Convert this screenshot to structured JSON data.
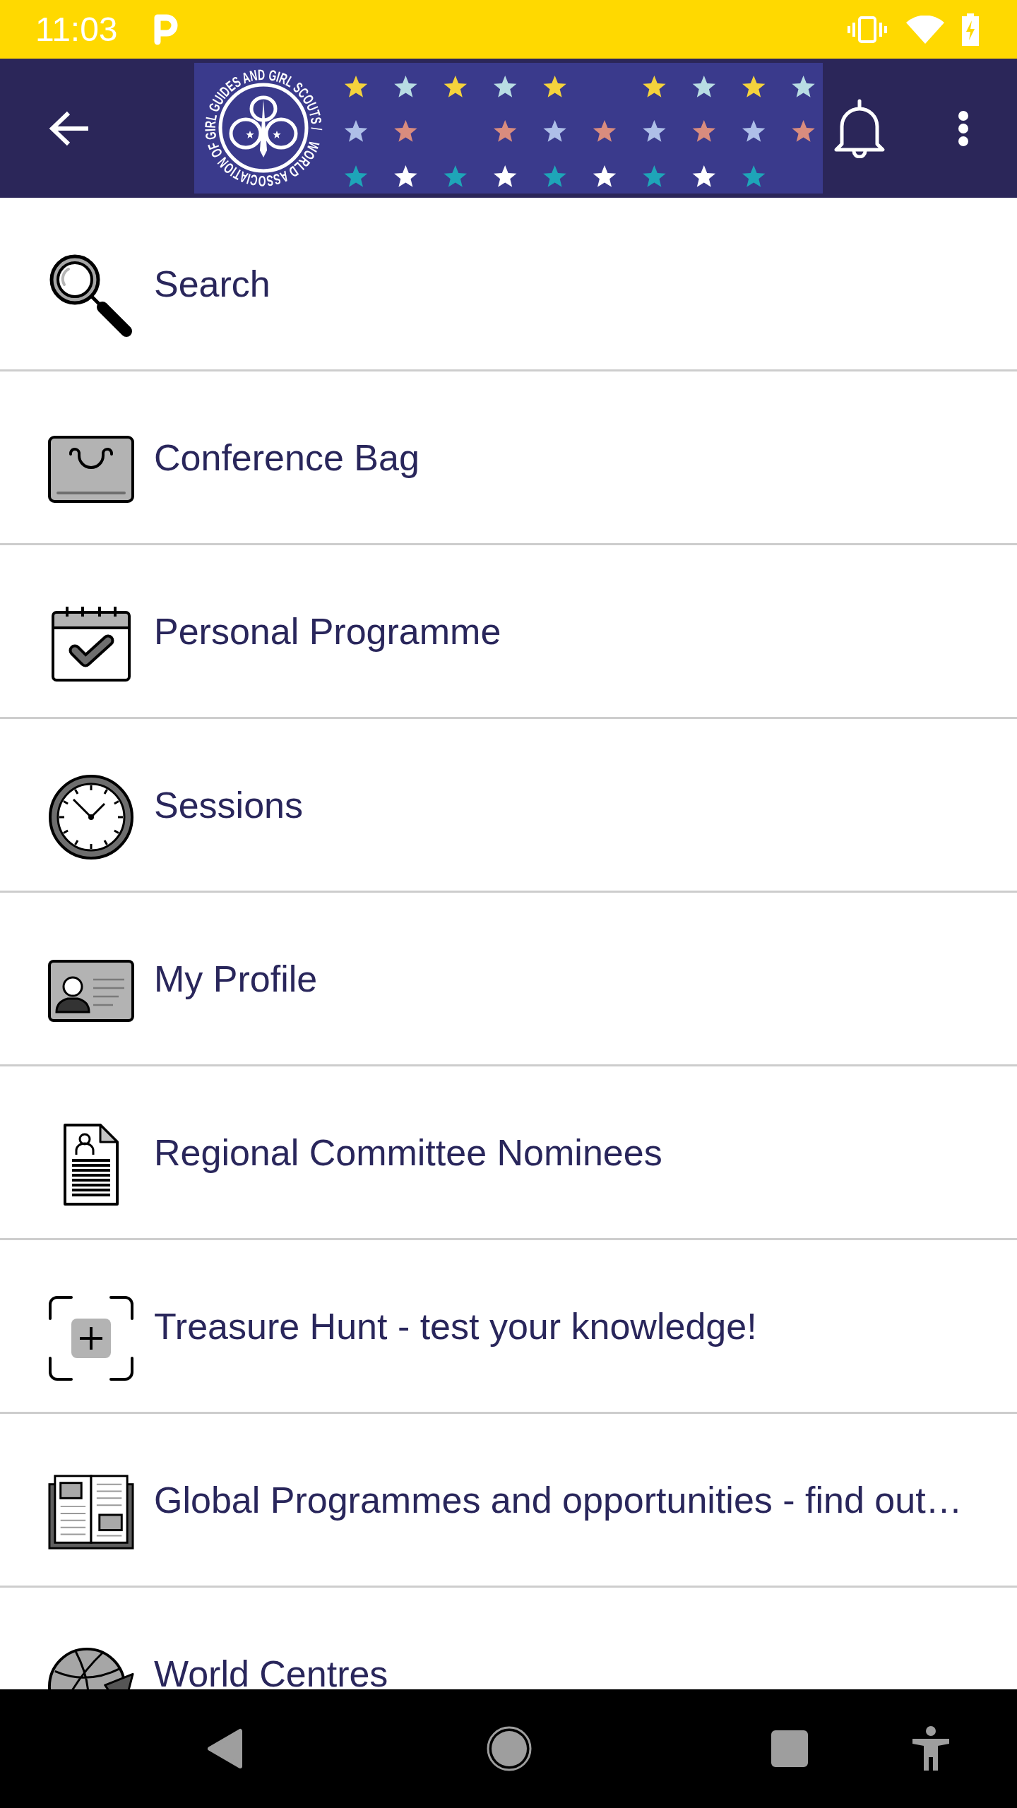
{
  "status_bar": {
    "time": "11:03"
  },
  "app_bar": {
    "logo_text": "WORLD ASSOCIATION OF GIRL GUIDES AND GIRL SCOUTS /"
  },
  "menu": [
    {
      "kind": "search",
      "label": "Search"
    },
    {
      "kind": "bag",
      "label": "Conference Bag"
    },
    {
      "kind": "calendar",
      "label": "Personal Programme"
    },
    {
      "kind": "clock",
      "label": "Sessions"
    },
    {
      "kind": "profile",
      "label": "My Profile"
    },
    {
      "kind": "document",
      "label": "Regional Committee Nominees"
    },
    {
      "kind": "scan",
      "label": "Treasure Hunt - test your knowledge!"
    },
    {
      "kind": "book",
      "label": "Global Programmes and opportunities - find out…"
    },
    {
      "kind": "globe",
      "label": "World Centres"
    }
  ]
}
